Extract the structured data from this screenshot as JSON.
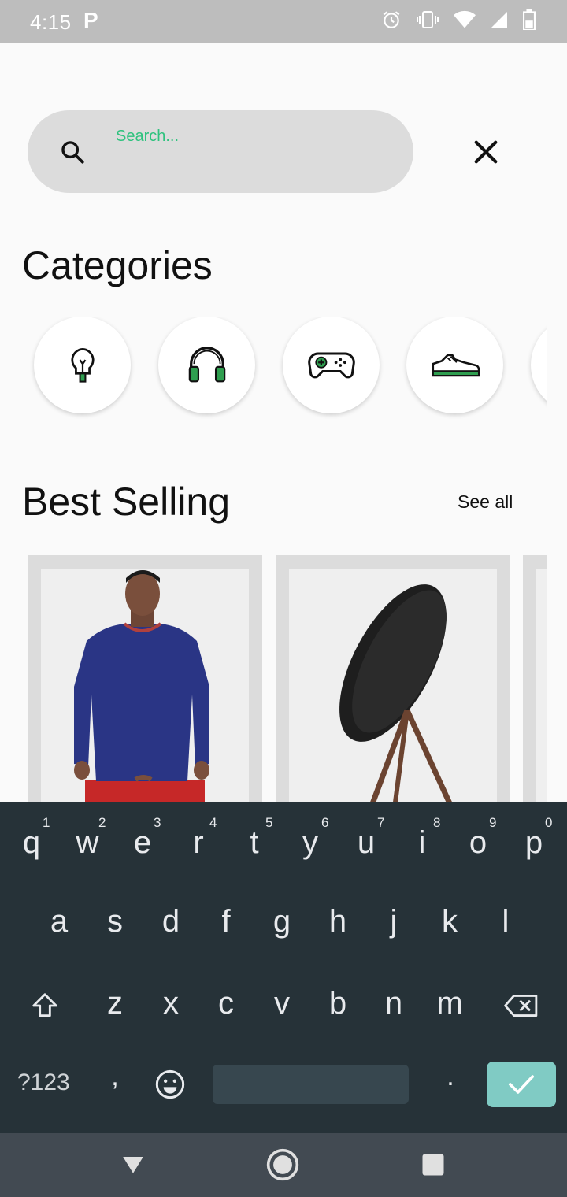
{
  "status_bar": {
    "time": "4:15",
    "app_letter": "P"
  },
  "search": {
    "placeholder": "Search..."
  },
  "categories": {
    "title": "Categories",
    "items": [
      {
        "icon": "lightbulb-icon"
      },
      {
        "icon": "headphones-icon"
      },
      {
        "icon": "gamepad-icon"
      },
      {
        "icon": "sneaker-icon"
      }
    ]
  },
  "best_selling": {
    "title": "Best Selling",
    "see_all": "See all",
    "products": [
      {
        "image": "sweater-model-image"
      },
      {
        "image": "speaker-image"
      }
    ]
  },
  "keyboard": {
    "row1": [
      "q",
      "w",
      "e",
      "r",
      "t",
      "y",
      "u",
      "i",
      "o",
      "p"
    ],
    "row1_nums": [
      "1",
      "2",
      "3",
      "4",
      "5",
      "6",
      "7",
      "8",
      "9",
      "0"
    ],
    "row2": [
      "a",
      "s",
      "d",
      "f",
      "g",
      "h",
      "j",
      "k",
      "l"
    ],
    "row3": [
      "z",
      "x",
      "c",
      "v",
      "b",
      "n",
      "m"
    ],
    "symbols": "?123",
    "comma": ",",
    "period": "."
  },
  "colors": {
    "accent": "#2ec27e",
    "keyboard_bg": "#263238",
    "enter": "#80cbc4"
  }
}
